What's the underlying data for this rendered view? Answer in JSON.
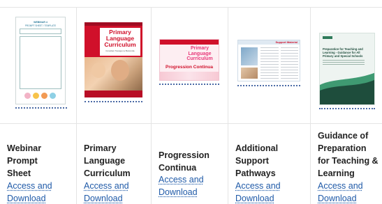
{
  "cards": [
    {
      "title_lines": [
        "Webinar",
        "Prompt",
        "Sheet"
      ],
      "link_lines": [
        "Access and",
        "Download"
      ],
      "thumb": {
        "line1": "WEBINAR 4",
        "line2": "PROMPT SHEET / TEMPLATE"
      }
    },
    {
      "title_lines": [
        "Primary",
        "Language",
        "Curriculum"
      ],
      "link_lines": [
        "Access and",
        "Download"
      ],
      "thumb": {
        "heading": [
          "Primary",
          "Language",
          "Curriculum"
        ],
        "sub": "Curaclam Teanga na Bunscoile"
      }
    },
    {
      "title_lines": [
        "Progression",
        "Continua"
      ],
      "link_lines": [
        "Access and",
        "Download"
      ],
      "thumb": {
        "heading": [
          "Primary",
          "Language",
          "Curriculum"
        ],
        "sub": "Progression Continua"
      }
    },
    {
      "title_lines": [
        "Additional",
        "Support",
        "Pathways"
      ],
      "link_lines": [
        "Access and",
        "Download"
      ],
      "thumb": {
        "header": "Support Material"
      }
    },
    {
      "title_lines": [
        "Guidance of",
        "Preparation",
        "for Teaching &",
        "Learning"
      ],
      "link_lines": [
        "Access and",
        "Download"
      ],
      "thumb": {
        "heading": [
          "Preparation for Teaching and",
          "Learning - Guidance for All",
          "Primary and Special Schools"
        ]
      }
    }
  ],
  "colors": {
    "link": "#1f5aa8",
    "title": "#222222",
    "accent_red": "#c8102e",
    "pink": "#e8397a",
    "dark_green": "#1e4d3c"
  }
}
